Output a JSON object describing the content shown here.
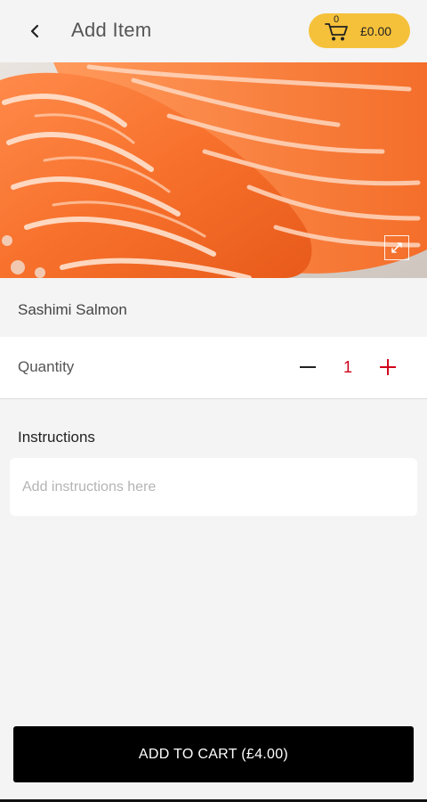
{
  "header": {
    "back_icon": "chevron-left-icon",
    "title": "Add Item",
    "cart": {
      "icon": "shopping-cart-icon",
      "count": "0",
      "total": "£0.00",
      "color": "#f5c13a"
    }
  },
  "hero": {
    "subject": "salmon sashimi",
    "expand_icon": "expand-icon"
  },
  "item": {
    "name": "Sashimi Salmon"
  },
  "quantity": {
    "label": "Quantity",
    "value": "1",
    "minus_icon": "minus-icon",
    "plus_icon": "plus-icon",
    "accent_color": "#d0021b"
  },
  "instructions": {
    "label": "Instructions",
    "placeholder": "Add instructions here",
    "value": ""
  },
  "actions": {
    "add_to_cart_label": "ADD TO CART (£4.00)"
  }
}
